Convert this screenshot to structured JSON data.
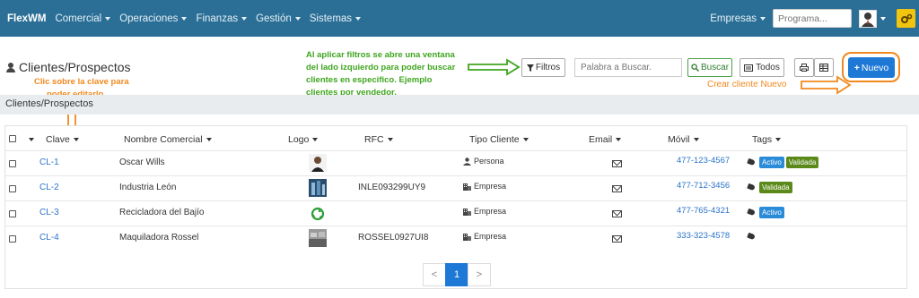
{
  "navbar": {
    "brand": "FlexWM",
    "menus": [
      "Comercial",
      "Operaciones",
      "Finanzas",
      "Gestión",
      "Sistemas"
    ],
    "empresas_label": "Empresas",
    "program_placeholder": "Programa..."
  },
  "page": {
    "title": "Clientes/Prospectos",
    "breadcrumb": "Clientes/Prospectos"
  },
  "annotations": {
    "filters_note": [
      "Al aplicar filtros se abre una ventana",
      "del lado izquierdo para poder buscar",
      "clientes en especifico. Ejemplo",
      "clientes por vendedor."
    ],
    "click_key_note": [
      "Clic sobre la clave para",
      "poder editarlo"
    ],
    "new_client_note": "Crear cliente Nuevo"
  },
  "toolbar": {
    "filters_label": "Filtros",
    "search_placeholder": "Palabra a Buscar.",
    "search_button": "Buscar",
    "all_button": "Todos",
    "new_button": "Nuevo"
  },
  "table": {
    "headers": {
      "clave": "Clave",
      "nombre": "Nombre Comercial",
      "logo": "Logo",
      "rfc": "RFC",
      "tipo": "Tipo Cliente",
      "email": "Email",
      "movil": "Móvil",
      "tags": "Tags"
    },
    "rows": [
      {
        "clave": "CL-1",
        "nombre": "Oscar Wills",
        "rfc": "",
        "tipo": "Persona",
        "movil": "477-123-4567",
        "tags": [
          "Activo",
          "Validada"
        ]
      },
      {
        "clave": "CL-2",
        "nombre": "Industria León",
        "rfc": "INLE093299UY9",
        "tipo": "Empresa",
        "movil": "477-712-3456",
        "tags": [
          "Validada"
        ]
      },
      {
        "clave": "CL-3",
        "nombre": "Recicladora del Bajío",
        "rfc": "",
        "tipo": "Empresa",
        "movil": "477-765-4321",
        "tags": [
          "Activo"
        ]
      },
      {
        "clave": "CL-4",
        "nombre": "Maquiladora Rossel",
        "rfc": "ROSSEL0927UI8",
        "tipo": "Empresa",
        "movil": "333-323-4578",
        "tags": []
      }
    ]
  },
  "pagination": {
    "prev": "<",
    "current": "1",
    "next": ">"
  },
  "colors": {
    "navbar": "#2b6f96",
    "primary": "#1e78d6",
    "annotation_green": "#3ea51e",
    "annotation_orange": "#f0891e",
    "tag_blue": "#2a8bd9",
    "tag_green": "#5b8a1a"
  }
}
